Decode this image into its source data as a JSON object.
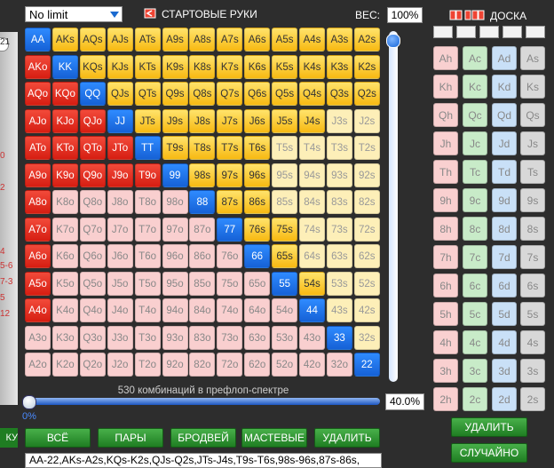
{
  "toolbar": {
    "limit_value": "No limit",
    "hands_title": "СТАРТОВЫЕ РУКИ",
    "weight_label": "ВЕС:",
    "weight_value": "100%"
  },
  "grid": {
    "rows": [
      [
        "AA",
        "AKs",
        "AQs",
        "AJs",
        "ATs",
        "A9s",
        "A8s",
        "A7s",
        "A6s",
        "A5s",
        "A4s",
        "A3s",
        "A2s"
      ],
      [
        "AKo",
        "KK",
        "KQs",
        "KJs",
        "KTs",
        "K9s",
        "K8s",
        "K7s",
        "K6s",
        "K5s",
        "K4s",
        "K3s",
        "K2s"
      ],
      [
        "AQo",
        "KQo",
        "QQ",
        "QJs",
        "QTs",
        "Q9s",
        "Q8s",
        "Q7s",
        "Q6s",
        "Q5s",
        "Q4s",
        "Q3s",
        "Q2s"
      ],
      [
        "AJo",
        "KJo",
        "QJo",
        "JJ",
        "JTs",
        "J9s",
        "J8s",
        "J7s",
        "J6s",
        "J5s",
        "J4s",
        "J3s",
        "J2s"
      ],
      [
        "ATo",
        "KTo",
        "QTo",
        "JTo",
        "TT",
        "T9s",
        "T8s",
        "T7s",
        "T6s",
        "T5s",
        "T4s",
        "T3s",
        "T2s"
      ],
      [
        "A9o",
        "K9o",
        "Q9o",
        "J9o",
        "T9o",
        "99",
        "98s",
        "97s",
        "96s",
        "95s",
        "94s",
        "93s",
        "92s"
      ],
      [
        "A8o",
        "K8o",
        "Q8o",
        "J8o",
        "T8o",
        "98o",
        "88",
        "87s",
        "86s",
        "85s",
        "84s",
        "83s",
        "82s"
      ],
      [
        "A7o",
        "K7o",
        "Q7o",
        "J7o",
        "T7o",
        "97o",
        "87o",
        "77",
        "76s",
        "75s",
        "74s",
        "73s",
        "72s"
      ],
      [
        "A6o",
        "K6o",
        "Q6o",
        "J6o",
        "T6o",
        "96o",
        "86o",
        "76o",
        "66",
        "65s",
        "64s",
        "63s",
        "62s"
      ],
      [
        "A5o",
        "K5o",
        "Q5o",
        "J5o",
        "T5o",
        "95o",
        "85o",
        "75o",
        "65o",
        "55",
        "54s",
        "53s",
        "52s"
      ],
      [
        "A4o",
        "K4o",
        "Q4o",
        "J4o",
        "T4o",
        "94o",
        "84o",
        "74o",
        "64o",
        "54o",
        "44",
        "43s",
        "42s"
      ],
      [
        "A3o",
        "K3o",
        "Q3o",
        "J3o",
        "T3o",
        "93o",
        "83o",
        "73o",
        "63o",
        "53o",
        "43o",
        "33",
        "32s"
      ],
      [
        "A2o",
        "K2o",
        "Q2o",
        "J2o",
        "T2o",
        "92o",
        "82o",
        "72o",
        "62o",
        "52o",
        "42o",
        "32o",
        "22"
      ]
    ],
    "states": [
      [
        "B",
        "Y",
        "Y",
        "Y",
        "Y",
        "Y",
        "Y",
        "Y",
        "Y",
        "Y",
        "Y",
        "Y",
        "Y"
      ],
      [
        "R",
        "B",
        "Y",
        "Y",
        "Y",
        "Y",
        "Y",
        "Y",
        "Y",
        "Y",
        "Y",
        "Y",
        "Y"
      ],
      [
        "R",
        "R",
        "B",
        "Y",
        "Y",
        "Y",
        "Y",
        "Y",
        "Y",
        "Y",
        "Y",
        "Y",
        "Y"
      ],
      [
        "R",
        "R",
        "R",
        "B",
        "Y",
        "Y",
        "Y",
        "Y",
        "Y",
        "Y",
        "Y",
        "y",
        "y"
      ],
      [
        "R",
        "R",
        "R",
        "R",
        "B",
        "Y",
        "Y",
        "Y",
        "Y",
        "y",
        "y",
        "y",
        "y"
      ],
      [
        "R",
        "R",
        "R",
        "R",
        "R",
        "B",
        "Y",
        "Y",
        "Y",
        "y",
        "y",
        "y",
        "y"
      ],
      [
        "R",
        "r",
        "r",
        "r",
        "r",
        "r",
        "B",
        "Y",
        "Y",
        "y",
        "y",
        "y",
        "y"
      ],
      [
        "R",
        "r",
        "r",
        "r",
        "r",
        "r",
        "r",
        "B",
        "Y",
        "Y",
        "y",
        "y",
        "y"
      ],
      [
        "R",
        "r",
        "r",
        "r",
        "r",
        "r",
        "r",
        "r",
        "B",
        "Y",
        "y",
        "y",
        "y"
      ],
      [
        "R",
        "r",
        "r",
        "r",
        "r",
        "r",
        "r",
        "r",
        "r",
        "B",
        "Y",
        "y",
        "y"
      ],
      [
        "R",
        "r",
        "r",
        "r",
        "r",
        "r",
        "r",
        "r",
        "r",
        "r",
        "B",
        "y",
        "y"
      ],
      [
        "r",
        "r",
        "r",
        "r",
        "r",
        "r",
        "r",
        "r",
        "r",
        "r",
        "r",
        "B",
        "y"
      ],
      [
        "r",
        "r",
        "r",
        "r",
        "r",
        "r",
        "r",
        "r",
        "r",
        "r",
        "r",
        "r",
        "B"
      ]
    ]
  },
  "range": {
    "combo_text": "530 комбинаций в префлоп-спектре",
    "slider_min_label": "0%",
    "percent_value": "40.0%",
    "percent_fraction": 0.4
  },
  "buttons": {
    "all": "ВСЁ",
    "pairs": "ПАРЫ",
    "broadway": "БРОДВЕЙ",
    "suited": "МАСТЕВЫЕ",
    "delete": "УДАЛИТЬ",
    "left_cut": "КУ"
  },
  "hand_text": "AA-22,AKs-A2s,KQs-K2s,QJs-Q2s,JTs-J4s,T9s-T6s,98s-96s,87s-86s,",
  "left_strip_numbers": [
    "21",
    "0",
    "2",
    "4",
    "5-6",
    "7-3",
    "5",
    "12"
  ],
  "board": {
    "title": "ДОСКА",
    "cards": [
      [
        "Ah",
        "Ac",
        "Ad",
        "As"
      ],
      [
        "Kh",
        "Kc",
        "Kd",
        "Ks"
      ],
      [
        "Qh",
        "Qc",
        "Qd",
        "Qs"
      ],
      [
        "Jh",
        "Jc",
        "Jd",
        "Js"
      ],
      [
        "Th",
        "Tc",
        "Td",
        "Ts"
      ],
      [
        "9h",
        "9c",
        "9d",
        "9s"
      ],
      [
        "8h",
        "8c",
        "8d",
        "8s"
      ],
      [
        "7h",
        "7c",
        "7d",
        "7s"
      ],
      [
        "6h",
        "6c",
        "6d",
        "6s"
      ],
      [
        "5h",
        "5c",
        "5d",
        "5s"
      ],
      [
        "4h",
        "4c",
        "4d",
        "4s"
      ],
      [
        "3h",
        "3c",
        "3d",
        "3s"
      ],
      [
        "2h",
        "2c",
        "2d",
        "2s"
      ]
    ],
    "delete_btn": "УДАЛИТЬ",
    "random_btn": "СЛУЧАЙНО"
  },
  "colors": {
    "red": "#e0281a",
    "blue": "#1c72ea",
    "yellow": "#fbc62a",
    "pale_red": "#f9cfcf",
    "pale_yellow": "#fdefb8",
    "green_button": "#2f9633"
  }
}
